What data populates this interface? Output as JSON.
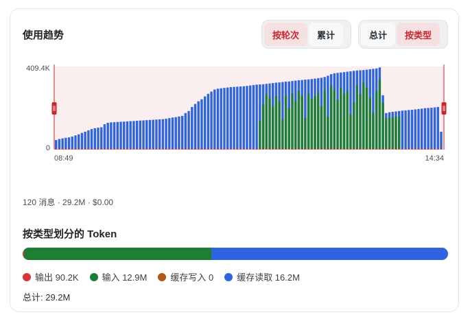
{
  "header": {
    "title": "使用趋势",
    "mode_toggle": {
      "per_turn_label": "按轮次",
      "cumulative_label": "累计",
      "active": "per_turn"
    },
    "view_toggle": {
      "total_label": "总计",
      "by_type_label": "按类型",
      "active": "by_type"
    }
  },
  "colors": {
    "output": "#d93636",
    "input": "#1e7e34",
    "cache_write": "#b5561b",
    "cache_read": "#2f64e0",
    "accent": "#c9262f",
    "range_fill": "#fbeeee"
  },
  "summary_text": "120 消息 · 29.2M · $0.00",
  "type_breakdown": {
    "title": "按类型划分的 Token",
    "legend": [
      {
        "key": "output",
        "label": "输出 90.2K",
        "color": "#d93636"
      },
      {
        "key": "input",
        "label": "输入 12.9M",
        "color": "#1e7e34"
      },
      {
        "key": "cache_write",
        "label": "缓存写入 0",
        "color": "#b5561b"
      },
      {
        "key": "cache_read",
        "label": "缓存读取 16.2M",
        "color": "#2f64e0"
      }
    ],
    "shares": {
      "output": 0.003,
      "input": 0.44,
      "cache_write": 0.0,
      "cache_read": 0.557
    },
    "total_label": "总计: 29.2M"
  },
  "chart_data": {
    "type": "bar",
    "stacked": true,
    "ylim": [
      0,
      409400
    ],
    "y_ticks": [
      "409.4K",
      "0"
    ],
    "x_tick_labels": [
      "08:49",
      "14:34"
    ],
    "series": [
      {
        "name": "输出",
        "color": "#d93636",
        "values": [
          400,
          400,
          400,
          400,
          400,
          400,
          400,
          400,
          400,
          400,
          400,
          400,
          400,
          400,
          400,
          400,
          400,
          400,
          400,
          400,
          400,
          400,
          400,
          400,
          400,
          400,
          400,
          400,
          400,
          400,
          400,
          400,
          400,
          400,
          400,
          400,
          400,
          400,
          400,
          400,
          400,
          400,
          400,
          400,
          400,
          400,
          400,
          400,
          400,
          400,
          400,
          400,
          400,
          400,
          400,
          400,
          400,
          400,
          400,
          400,
          400,
          400,
          400,
          400,
          400,
          400,
          400,
          400,
          400,
          400,
          400,
          400,
          400,
          400,
          400,
          400,
          400,
          400,
          400,
          400,
          400,
          400,
          400,
          400,
          400,
          400,
          400,
          400,
          400,
          400,
          400,
          400,
          400,
          400,
          400,
          400,
          400,
          400,
          400,
          400,
          400,
          400,
          400,
          400,
          400,
          400,
          400,
          400,
          400,
          400,
          400,
          400,
          400,
          400,
          400,
          400,
          400,
          400,
          400,
          400
        ]
      },
      {
        "name": "输入",
        "color": "#1e7e34",
        "values": [
          0,
          0,
          0,
          0,
          0,
          0,
          0,
          0,
          0,
          0,
          0,
          0,
          0,
          0,
          0,
          0,
          0,
          0,
          0,
          0,
          0,
          0,
          0,
          0,
          0,
          0,
          0,
          0,
          0,
          0,
          0,
          0,
          0,
          0,
          0,
          0,
          0,
          0,
          0,
          0,
          0,
          0,
          0,
          0,
          0,
          0,
          0,
          0,
          0,
          0,
          0,
          0,
          0,
          0,
          0,
          0,
          0,
          0,
          0,
          0,
          0,
          0,
          0,
          0,
          0,
          0,
          0,
          0,
          0,
          0,
          0,
          0,
          0,
          0,
          0,
          0,
          0,
          0,
          0,
          0,
          0,
          0,
          0,
          0,
          0,
          0,
          0,
          0,
          0,
          0,
          0,
          0,
          0,
          0,
          0,
          0,
          0,
          0,
          0,
          0,
          0,
          0,
          0,
          0,
          0,
          0,
          0,
          0,
          0,
          0,
          0,
          0,
          0,
          0,
          0,
          0,
          0,
          0,
          0,
          0
        ]
      },
      {
        "name": "缓存读取",
        "color": "#2f64e0",
        "values": [
          0,
          0,
          0,
          0,
          0,
          0,
          0,
          0,
          0,
          0,
          0,
          0,
          0,
          0,
          0,
          0,
          0,
          0,
          0,
          0,
          0,
          0,
          0,
          0,
          0,
          0,
          0,
          0,
          0,
          0,
          0,
          0,
          0,
          0,
          0,
          0,
          0,
          0,
          0,
          0,
          0,
          0,
          0,
          0,
          0,
          0,
          0,
          0,
          0,
          0,
          0,
          0,
          0,
          0,
          0,
          0,
          0,
          0,
          0,
          0,
          0,
          0,
          0,
          0,
          0,
          0,
          0,
          0,
          0,
          0,
          0,
          0,
          0,
          0,
          0,
          0,
          0,
          0,
          0,
          0,
          0,
          0,
          0,
          0,
          0,
          0,
          0,
          0,
          0,
          0,
          0,
          0,
          0,
          0,
          0,
          0,
          0,
          0,
          0,
          0,
          0,
          0,
          0,
          0,
          0,
          0,
          0,
          0,
          0,
          0,
          0,
          0,
          0,
          0,
          0,
          0,
          0,
          0,
          0,
          0
        ]
      }
    ],
    "totals": [
      47000,
      52000,
      55000,
      58000,
      60000,
      64000,
      70000,
      75000,
      82000,
      88000,
      95000,
      101000,
      105000,
      108000,
      110000,
      125000,
      132000,
      134000,
      135000,
      136000,
      137000,
      138000,
      139000,
      140000,
      141000,
      142000,
      143000,
      144000,
      145000,
      146000,
      147000,
      148000,
      149000,
      150000,
      152000,
      155000,
      158000,
      160000,
      163000,
      166000,
      180000,
      190000,
      210000,
      225000,
      238000,
      248000,
      262000,
      275000,
      286000,
      296000,
      300000,
      302000,
      304000,
      306000,
      308000,
      309000,
      310000,
      311000,
      312000,
      314000,
      316000,
      318000,
      320000,
      321000,
      322000,
      324000,
      326000,
      328000,
      330000,
      331000,
      333000,
      335000,
      336000,
      338000,
      340000,
      342000,
      343000,
      345000,
      346000,
      348000,
      350000,
      352000,
      354000,
      358000,
      364000,
      372000,
      376000,
      378000,
      380000,
      382000,
      384000,
      386000,
      388000,
      390000,
      391000,
      392000,
      394000,
      396000,
      398000,
      400000,
      405000,
      268000,
      180000,
      184000,
      186000,
      188000,
      190000,
      192000,
      193000,
      195000,
      196000,
      198000,
      200000,
      202000,
      204000,
      205000,
      206000,
      208000,
      210000,
      88000
    ],
    "input_values": [
      0,
      0,
      0,
      0,
      0,
      0,
      0,
      0,
      0,
      0,
      0,
      0,
      0,
      0,
      0,
      0,
      0,
      0,
      0,
      0,
      0,
      0,
      0,
      0,
      0,
      0,
      0,
      0,
      0,
      0,
      0,
      0,
      0,
      0,
      0,
      0,
      0,
      0,
      0,
      0,
      4000,
      4000,
      4000,
      4000,
      4000,
      4000,
      0,
      0,
      0,
      0,
      0,
      0,
      0,
      0,
      0,
      0,
      0,
      0,
      0,
      0,
      0,
      0,
      0,
      0,
      0,
      0,
      0,
      0,
      0,
      0,
      0,
      0,
      0,
      0,
      0,
      0,
      0,
      0,
      0,
      0,
      0,
      0,
      0,
      0,
      0,
      0,
      0,
      0,
      0,
      0,
      0,
      0,
      0,
      0,
      0,
      0,
      0,
      0,
      0,
      0,
      0,
      0,
      0,
      0,
      0,
      0,
      0,
      0,
      0,
      0,
      0,
      0,
      0,
      0,
      0,
      0,
      0,
      0,
      0,
      0
    ],
    "annotations": "filled range across the whole x extent with drag handles at both ends"
  }
}
